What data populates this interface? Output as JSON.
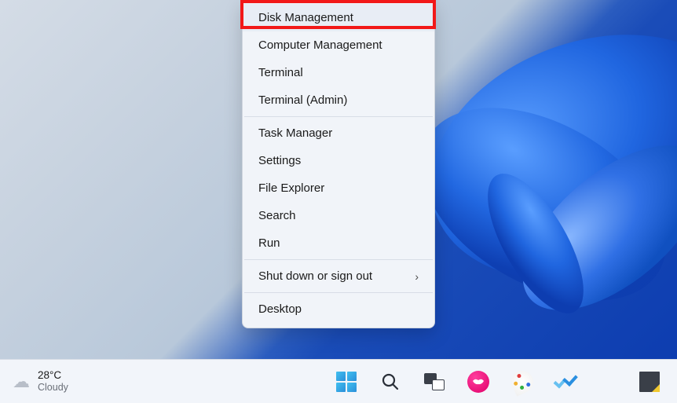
{
  "menu": {
    "items": [
      {
        "label": "Disk Management",
        "highlighted": true
      },
      {
        "label": "Computer Management"
      },
      {
        "label": "Terminal"
      },
      {
        "label": "Terminal (Admin)"
      }
    ],
    "items2": [
      {
        "label": "Task Manager"
      },
      {
        "label": "Settings"
      },
      {
        "label": "File Explorer"
      },
      {
        "label": "Search"
      },
      {
        "label": "Run"
      }
    ],
    "items3": [
      {
        "label": "Shut down or sign out",
        "submenu": true
      }
    ],
    "items4": [
      {
        "label": "Desktop"
      }
    ]
  },
  "weather": {
    "temp": "28°C",
    "condition": "Cloudy"
  },
  "taskbar": {
    "icons": [
      {
        "name": "start"
      },
      {
        "name": "search"
      },
      {
        "name": "taskview"
      },
      {
        "name": "lips-app"
      },
      {
        "name": "paint"
      },
      {
        "name": "todo"
      }
    ]
  }
}
